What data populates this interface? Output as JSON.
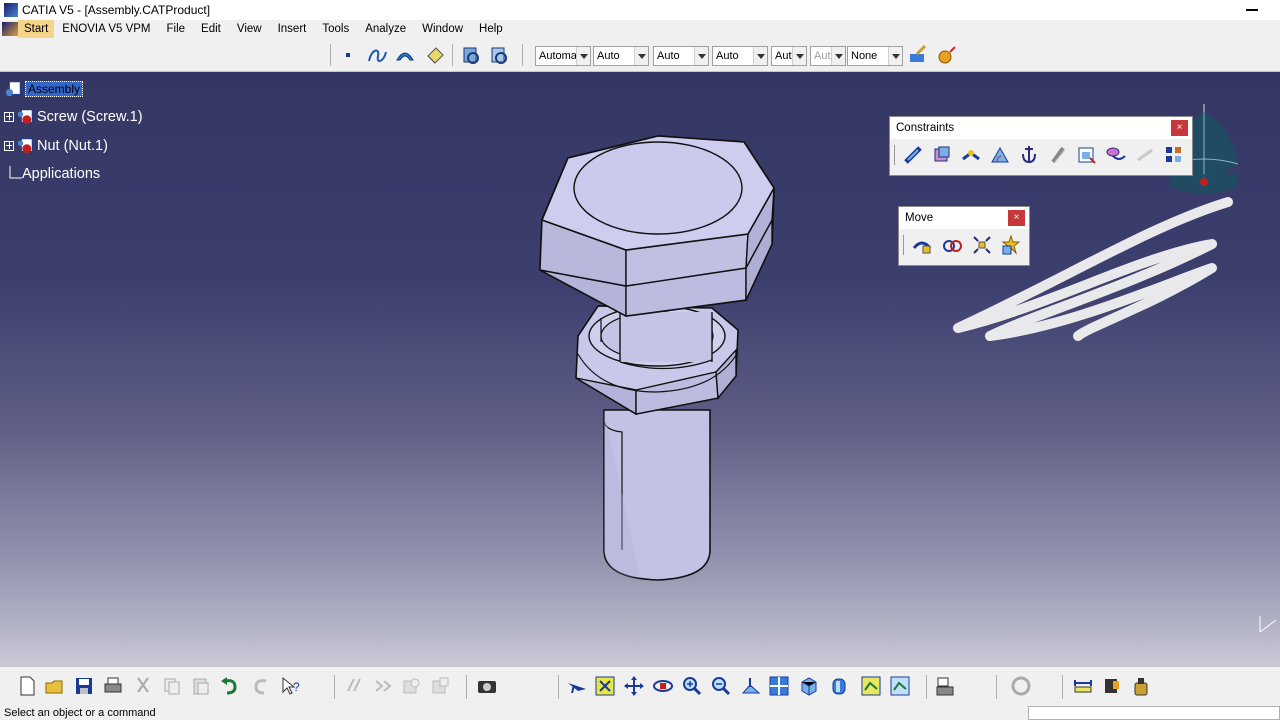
{
  "window": {
    "title": "CATIA V5 - [Assembly.CATProduct]"
  },
  "menu": {
    "items": [
      {
        "label": "Start"
      },
      {
        "label": "ENOVIA V5 VPM"
      },
      {
        "label": "File"
      },
      {
        "label": "Edit"
      },
      {
        "label": "View"
      },
      {
        "label": "Insert"
      },
      {
        "label": "Tools"
      },
      {
        "label": "Analyze"
      },
      {
        "label": "Window"
      },
      {
        "label": "Help"
      }
    ]
  },
  "graphic_properties": {
    "combos": [
      {
        "value": "Automa"
      },
      {
        "value": "Auto"
      },
      {
        "value": "Auto"
      },
      {
        "value": "Auto"
      },
      {
        "value": "Aut"
      },
      {
        "value": "Aut"
      },
      {
        "value": "None"
      }
    ]
  },
  "tree": {
    "root": "Assembly",
    "children": [
      {
        "label": "Screw (Screw.1)"
      },
      {
        "label": "Nut (Nut.1)"
      }
    ],
    "applications": "Applications"
  },
  "palettes": {
    "constraints": {
      "title": "Constraints",
      "close": "×"
    },
    "move": {
      "title": "Move",
      "close": "×"
    }
  },
  "status": {
    "message": "Select an object or a command"
  },
  "colors": {
    "viewport_top": "#343663",
    "viewport_bottom": "#c8c8d6",
    "part_face": "#c8c8e8",
    "selection": "#3366cc"
  }
}
